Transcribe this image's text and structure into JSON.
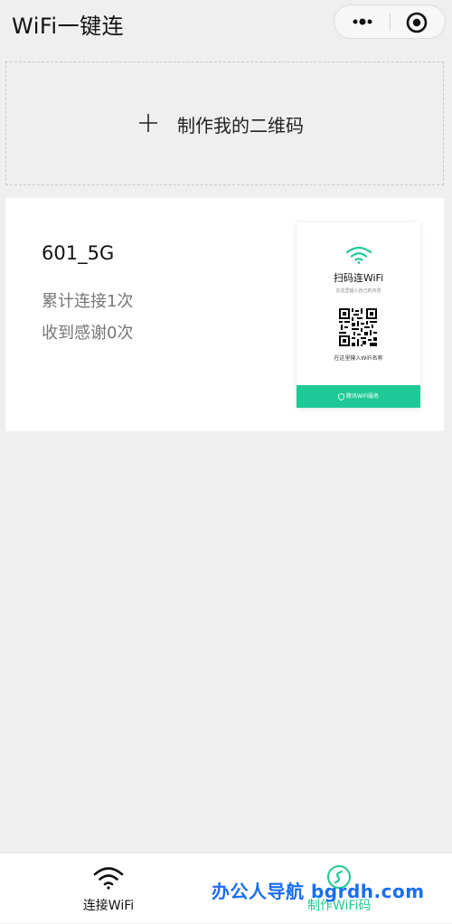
{
  "app": {
    "title": "WiFi一键连"
  },
  "create": {
    "label": "制作我的二维码"
  },
  "card": {
    "ssid": "601_5G",
    "connect_count": "累计连接1次",
    "thanks_count": "收到感谢0次",
    "poster": {
      "title": "扫码连WiFi",
      "subtitle": "在这里输入自己的内容",
      "hint": "在这里输入WiFi名称",
      "footer": "腾讯WiFi服务"
    }
  },
  "tabbar": {
    "connect_label": "连接WiFi",
    "make_label": "制作WiFi码"
  },
  "watermark": "办公人导航 bgrdh.com",
  "colors": {
    "accent": "#1ec995",
    "background": "#efefef",
    "watermark": "#1a6ef0"
  },
  "icons": [
    "more-icon",
    "close-icon",
    "plus-icon",
    "wifi-icon",
    "qr-code",
    "shield-icon",
    "wifi-code-icon"
  ]
}
